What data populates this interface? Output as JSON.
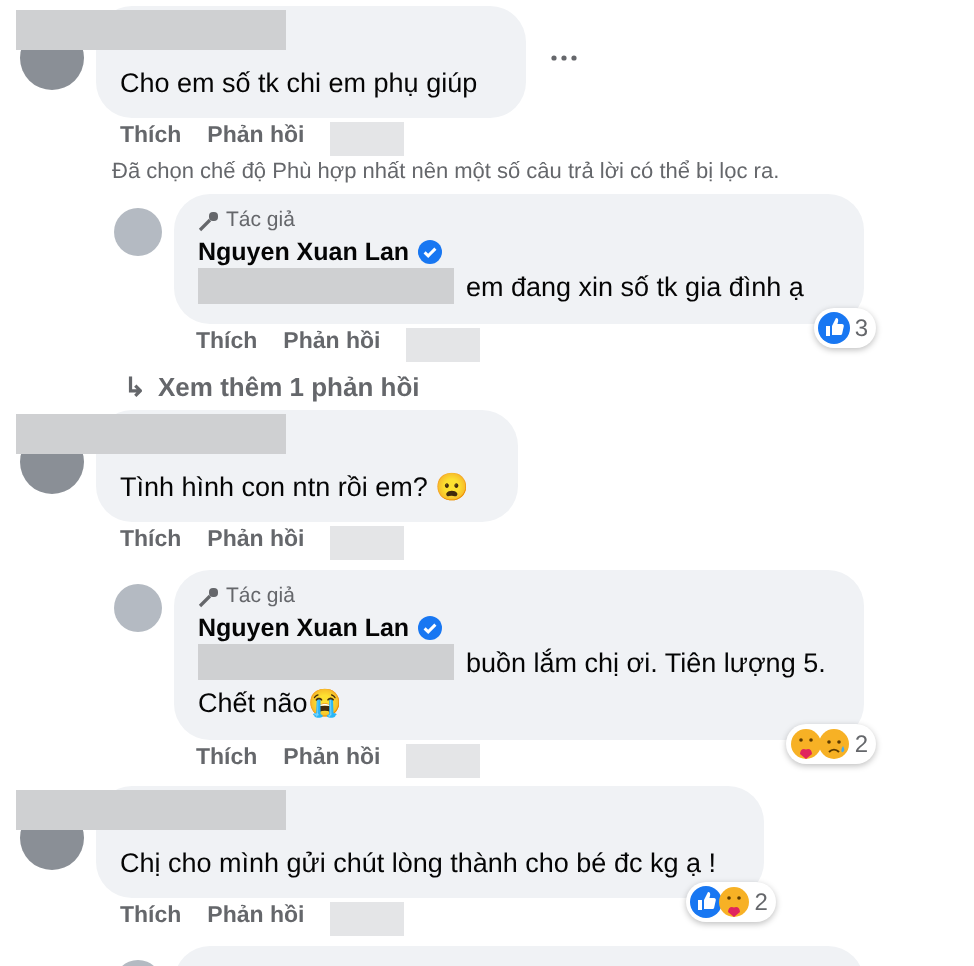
{
  "notice": "Đã chọn chế độ Phù hợp nhất nên một số câu trả lời có thể bị lọc ra.",
  "items": [
    {
      "kind": "comment",
      "name_redacted": true,
      "text": "Cho em số tk chi em phụ giúp",
      "menu": true,
      "actions": [
        "Thích",
        "Phản hồi"
      ],
      "time_redacted": true
    },
    {
      "kind": "notice"
    },
    {
      "kind": "reply",
      "badge": "Tác giả",
      "author": "Nguyen Xuan Lan",
      "verified": true,
      "text": "em đang xin số tk gia đình ạ",
      "text_redacted_prefix": true,
      "actions": [
        "Thích",
        "Phản hồi"
      ],
      "time_redacted": true,
      "reactions": [
        {
          "kind": "like"
        }
      ],
      "count": "3"
    },
    {
      "kind": "more",
      "arrow": "↳",
      "label": "Xem thêm 1 phản hồi"
    },
    {
      "kind": "comment",
      "name_redacted": true,
      "text": "Tình hình con ntn rồi em? 😦",
      "actions": [
        "Thích",
        "Phản hồi"
      ],
      "time_redacted": true
    },
    {
      "kind": "reply",
      "badge": "Tác giả",
      "author": "Nguyen Xuan Lan",
      "verified": true,
      "text": "buồn lắm chị ơi. Tiên lượng 5.",
      "text2": "Chết não😭",
      "text_redacted_prefix": true,
      "actions": [
        "Thích",
        "Phản hồi"
      ],
      "time_redacted": true,
      "reactions": [
        {
          "kind": "care"
        },
        {
          "kind": "sad"
        }
      ],
      "count": "2"
    },
    {
      "kind": "comment",
      "name_redacted": true,
      "text": "Chị cho mình gửi chút lòng thành cho bé đc kg ạ !",
      "actions": [
        "Thích",
        "Phản hồi"
      ],
      "time_redacted": true,
      "reactions": [
        {
          "kind": "like"
        },
        {
          "kind": "care"
        }
      ],
      "count": "2"
    },
    {
      "kind": "stub"
    }
  ]
}
